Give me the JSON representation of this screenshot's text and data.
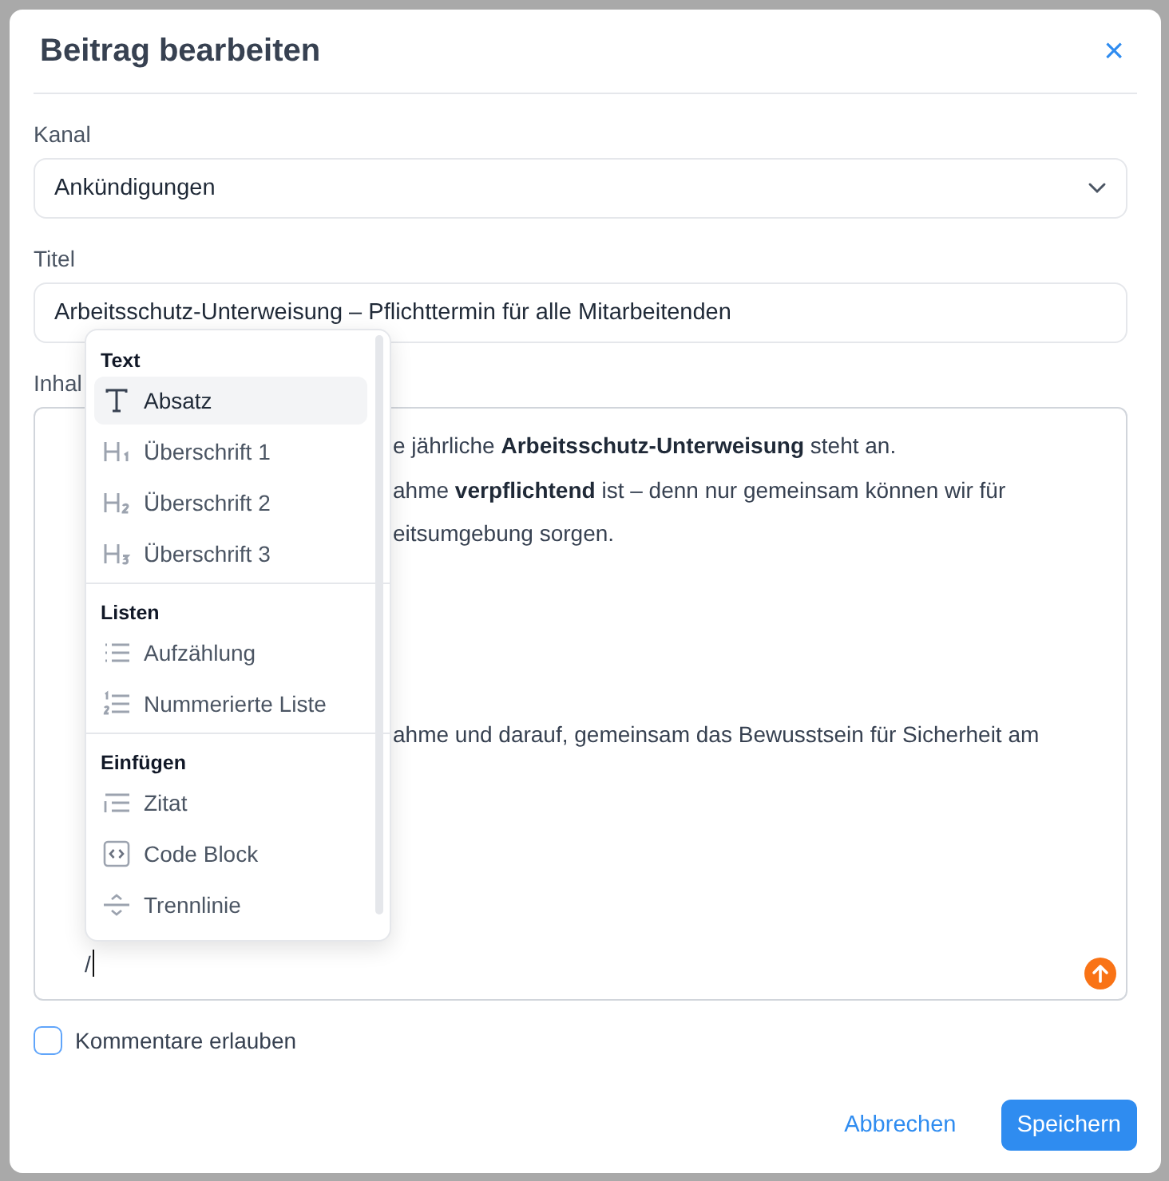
{
  "dialog": {
    "title": "Beitrag bearbeiten",
    "close": "×"
  },
  "channel": {
    "label": "Kanal",
    "value": "Ankündigungen"
  },
  "title_field": {
    "label": "Titel",
    "value": "Arbeitsschutz-Unterweisung – Pflichttermin für alle Mitarbeitenden"
  },
  "content": {
    "label": "Inhal",
    "blocks": [
      {
        "lines": [
          "e jährliche **Arbeitsschutz-Unterweisung** steht an.",
          "ahme **verpflichtend** ist – denn nur gemeinsam können wir für",
          "eitsumgebung sorgen."
        ]
      },
      {
        "lines": [
          "ahme und darauf, gemeinsam das Bewusstsein für Sicherheit am"
        ]
      }
    ],
    "input": "/"
  },
  "slash_menu": [
    {
      "heading": "Text",
      "items": [
        {
          "kind": "paragraph",
          "label": "Absatz",
          "selected": true
        },
        {
          "kind": "h1",
          "label": "Überschrift 1",
          "selected": false
        },
        {
          "kind": "h2",
          "label": "Überschrift 2",
          "selected": false
        },
        {
          "kind": "h3",
          "label": "Überschrift 3",
          "selected": false
        }
      ]
    },
    {
      "heading": "Listen",
      "items": [
        {
          "kind": "bullet",
          "label": "Aufzählung",
          "selected": false
        },
        {
          "kind": "ordered",
          "label": "Nummerierte Liste",
          "selected": false
        }
      ]
    },
    {
      "heading": "Einfügen",
      "items": [
        {
          "kind": "quote",
          "label": "Zitat",
          "selected": false
        },
        {
          "kind": "code",
          "label": "Code Block",
          "selected": false
        },
        {
          "kind": "divider",
          "label": "Trennlinie",
          "selected": false
        }
      ]
    }
  ],
  "allow_comments": {
    "label": "Kommentare erlauben",
    "checked": false
  },
  "buttons": {
    "cancel": "Abbrechen",
    "save": "Speichern"
  }
}
